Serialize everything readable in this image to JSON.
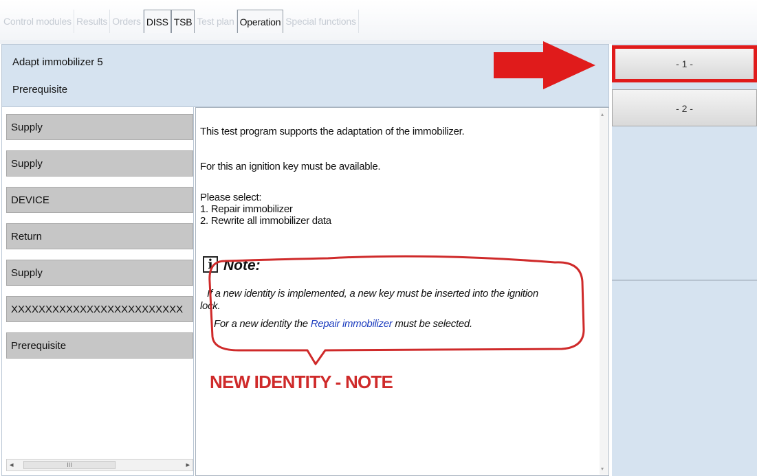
{
  "tabs": [
    {
      "label": "Control modules",
      "active": false
    },
    {
      "label": "Results",
      "active": false
    },
    {
      "label": "Orders",
      "active": false
    },
    {
      "label": "DISS",
      "active": true
    },
    {
      "label": "TSB",
      "active": true
    },
    {
      "label": "Test plan",
      "active": false
    },
    {
      "label": "Operation",
      "active": true
    },
    {
      "label": "Special functions",
      "active": false
    }
  ],
  "header": {
    "title": "Adapt immobilizer 5",
    "subtitle": "Prerequisite"
  },
  "left_buttons": [
    "Supply",
    "Supply",
    "DEVICE",
    "Return",
    "Supply",
    "XXXXXXXXXXXXXXXXXXXXXXXXX",
    "Prerequisite"
  ],
  "content": {
    "line1": "This test program supports the adaptation of the immobilizer.",
    "line2": "For this an ignition key must be available.",
    "select_label": "Please select:",
    "option1": "1. Repair immobilizer",
    "option2": "2. Rewrite all immobilizer data",
    "note_icon": "i",
    "note_title": "Note:",
    "note_line1": "If a new identity is implemented, a new key must be inserted into the ignition",
    "note_line1b": "lock.",
    "note_line2_pre": "For a new identity the ",
    "note_link": "Repair immobilizer",
    "note_line2_post": " must be selected."
  },
  "annotation": {
    "label": "NEW IDENTITY - NOTE",
    "color": "#cf2a2a"
  },
  "right_buttons": [
    "- 1 -",
    "- 2 -"
  ],
  "scrollbar_thumb": "III",
  "icons": {
    "arrow": "red-arrow-icon",
    "info": "info-icon",
    "scroll_left": "◂",
    "scroll_right": "▸",
    "scroll_up": "▴",
    "scroll_down": "▾"
  },
  "colors": {
    "header_bg": "#d6e3f0",
    "button_grey": "#c6c6c6",
    "highlight_red": "#e01b1b",
    "link_blue": "#1f3fbf"
  }
}
